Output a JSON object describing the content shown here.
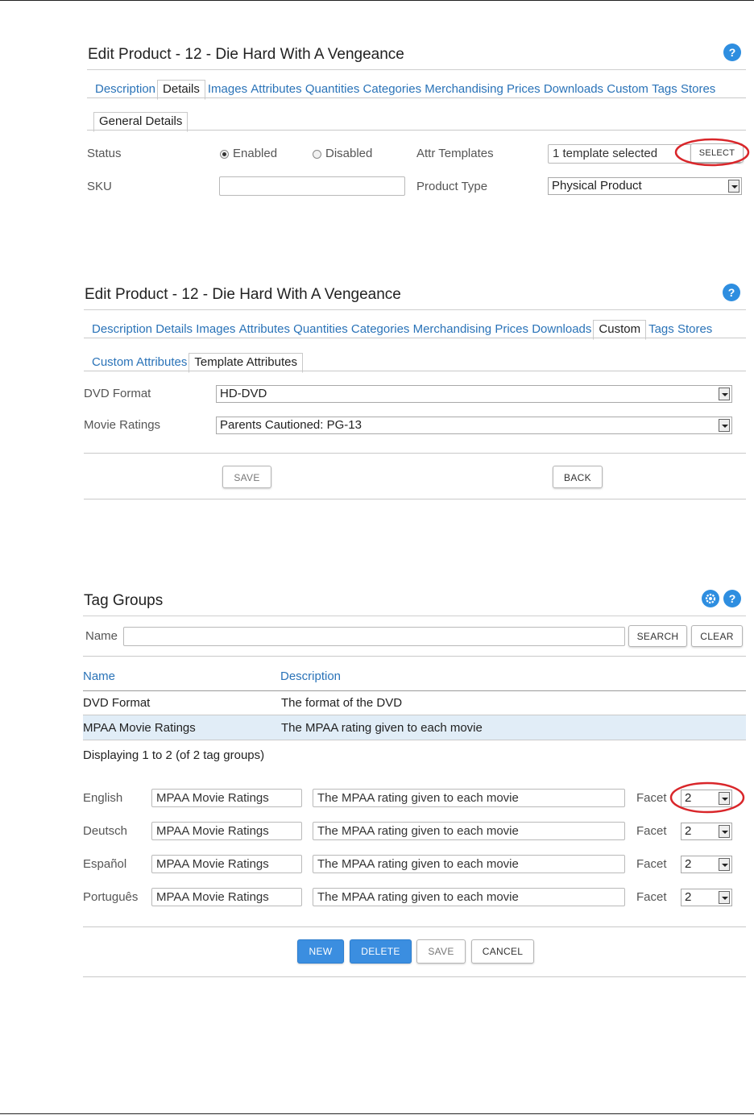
{
  "panel1": {
    "title": "Edit Product - 12 - Die Hard With A Vengeance",
    "help_icon": "?",
    "tabs": [
      "Description",
      "Details",
      "Images",
      "Attributes",
      "Quantities",
      "Categories",
      "Merchandising",
      "Prices",
      "Downloads",
      "Custom",
      "Tags",
      "Stores"
    ],
    "active_tab": "Details",
    "subtab": "General Details",
    "status_label": "Status",
    "enabled_label": "Enabled",
    "disabled_label": "Disabled",
    "status_value": "Enabled",
    "attr_templates_label": "Attr Templates",
    "attr_templates_value": "1 template selected",
    "select_button": "SELECT",
    "sku_label": "SKU",
    "sku_value": "",
    "product_type_label": "Product Type",
    "product_type_value": "Physical Product"
  },
  "panel2": {
    "title": "Edit Product - 12 - Die Hard With A Vengeance",
    "help_icon": "?",
    "tabs": [
      "Description",
      "Details",
      "Images",
      "Attributes",
      "Quantities",
      "Categories",
      "Merchandising",
      "Prices",
      "Downloads",
      "Custom",
      "Tags",
      "Stores"
    ],
    "active_tab": "Custom",
    "subtabs": [
      "Custom Attributes",
      "Template Attributes"
    ],
    "active_subtab": "Template Attributes",
    "dvd_format_label": "DVD Format",
    "dvd_format_value": "HD-DVD",
    "movie_ratings_label": "Movie Ratings",
    "movie_ratings_value": "Parents Cautioned: PG-13",
    "save_button": "SAVE",
    "back_button": "BACK"
  },
  "panel3": {
    "title": "Tag Groups",
    "help_icon": "?",
    "name_label": "Name",
    "name_value": "",
    "search_button": "SEARCH",
    "clear_button": "CLEAR",
    "columns": [
      "Name",
      "Description"
    ],
    "rows": [
      {
        "name": "DVD Format",
        "description": "The format of the DVD",
        "selected": false
      },
      {
        "name": "MPAA Movie Ratings",
        "description": "The MPAA rating given to each movie",
        "selected": true
      }
    ],
    "paging": "Displaying 1 to 2 (of 2 tag groups)",
    "facet_label": "Facet",
    "languages": [
      {
        "lang": "English",
        "name": "MPAA Movie Ratings",
        "description": "The MPAA rating given to each movie",
        "facet": "2"
      },
      {
        "lang": "Deutsch",
        "name": "MPAA Movie Ratings",
        "description": "The MPAA rating given to each movie",
        "facet": "2"
      },
      {
        "lang": "Español",
        "name": "MPAA Movie Ratings",
        "description": "The MPAA rating given to each movie",
        "facet": "2"
      },
      {
        "lang": "Português",
        "name": "MPAA Movie Ratings",
        "description": "The MPAA rating given to each movie",
        "facet": "2"
      }
    ],
    "new_button": "NEW",
    "delete_button": "DELETE",
    "save_button": "SAVE",
    "cancel_button": "CANCEL"
  },
  "colors": {
    "accent": "#2e8ee0",
    "link": "#2a73b8",
    "highlight_row": "#e1edf7",
    "annotation": "#d9262a"
  }
}
